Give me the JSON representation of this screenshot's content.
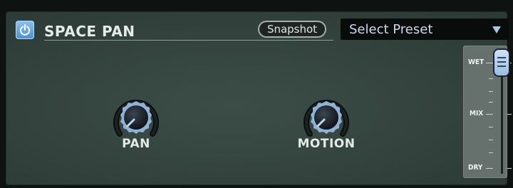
{
  "plugin": {
    "title": "SPACE PAN",
    "snapshot_label": "Snapshot",
    "preset_label": "Select Preset",
    "power_icon": "power-icon"
  },
  "knobs": [
    {
      "label": "PAN",
      "icon": "knob-icon"
    },
    {
      "label": "MOTION",
      "icon": "knob-icon"
    }
  ],
  "mix": {
    "labels": {
      "top": "WET",
      "middle": "MIX",
      "bottom": "DRY"
    },
    "value": 1.0
  },
  "colors": {
    "panel": "#33423d",
    "accent": "#6aa6dc",
    "text": "#e4ebe8"
  }
}
